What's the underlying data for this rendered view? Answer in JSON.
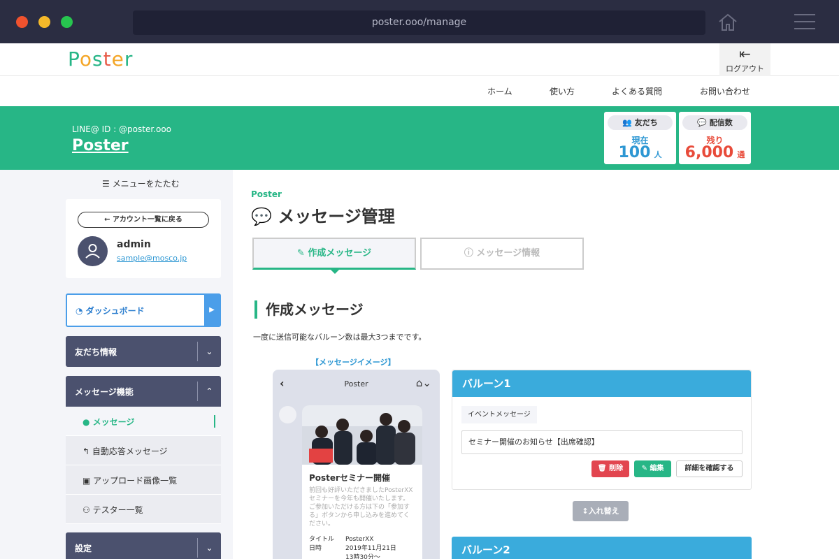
{
  "browser": {
    "url": "poster.ooo/manage"
  },
  "header": {
    "logo_text": "Poster",
    "logout_label": "ログアウト"
  },
  "nav": {
    "items": [
      "ホーム",
      "使い方",
      "よくある質問",
      "お問い合わせ"
    ]
  },
  "account": {
    "line_id": "LINE@ ID : @poster.ooo",
    "name": "Poster"
  },
  "stats": {
    "friends": {
      "pill": "友だち",
      "label": "現在",
      "value": "100",
      "unit": "人"
    },
    "deliveries": {
      "pill": "配信数",
      "label": "残り",
      "value": "6,000",
      "unit": "通"
    }
  },
  "sidebar": {
    "collapse_label": "メニューをたたむ",
    "back_button": "アカウント一覧に戻る",
    "user_name": "admin",
    "user_email": "sample@mosco.jp",
    "dashboard": "ダッシュボード",
    "sections": {
      "friends_info": "友だち情報",
      "message_features": "メッセージ機能",
      "settings": "設定"
    },
    "submenu": [
      "メッセージ",
      "自動応答メッセージ",
      "アップロード画像一覧",
      "テスター一覧"
    ]
  },
  "main": {
    "breadcrumb": "Poster",
    "page_title": "メッセージ管理",
    "tabs": [
      "作成メッセージ",
      "メッセージ情報"
    ],
    "section_title": "作成メッセージ",
    "note": "一度に送信可能なバルーン数は最大3つまでです。",
    "preview_label": "【メッセージイメージ】"
  },
  "preview": {
    "header_title": "Poster",
    "card_title": "Posterセミナー開催",
    "card_desc": "前回も好評いただきましたPosterXXセミナーを今年も開催いたします。ご参加いただける方は下の「参加する」ボタンから申し込みを進めてください。",
    "rows": [
      {
        "key": "タイトル",
        "value": "PosterXX"
      },
      {
        "key": "日時",
        "value": "2019年11月21日"
      },
      {
        "key": "",
        "value": "13時30分〜"
      }
    ]
  },
  "balloons": [
    {
      "title": "バルーン1",
      "type": "イベントメッセージ",
      "text": "セミナー開催のお知らせ【出席確認】",
      "buttons": {
        "delete": "削除",
        "edit": "編集",
        "detail": "詳細を確認する"
      }
    },
    {
      "title": "バルーン2"
    }
  ],
  "swap_label": "入れ替え",
  "colors": {
    "brand_green": "#27b686",
    "sidebar_dark": "#4b516e",
    "balloon_blue": "#3aabdc",
    "danger": "#e2454f"
  }
}
